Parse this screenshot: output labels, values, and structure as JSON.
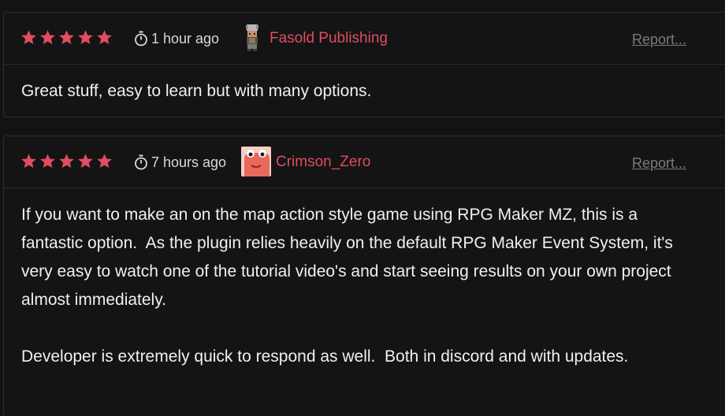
{
  "colors": {
    "background": "#131313",
    "border": "#2d2d2d",
    "star": "#de4d60",
    "author": "#de4d60",
    "report": "#7b7b7b",
    "text": "#f0f0f0"
  },
  "reviews": [
    {
      "rating": 5,
      "time": "1 hour ago",
      "author": "Fasold Publishing",
      "avatar_icon": "pixel-character-chef-avatar",
      "report_label": "Report...",
      "body": "Great stuff, easy to learn but with many options."
    },
    {
      "rating": 5,
      "time": "7 hours ago",
      "author": "Crimson_Zero",
      "avatar_icon": "pink-blob-creature-avatar",
      "report_label": "Report...",
      "body": "If you want to make an on the map action style game using RPG Maker MZ, this is a fantastic option.  As the plugin relies heavily on the default RPG Maker Event System, it's very easy to watch one of the tutorial video's and start seeing results on your own project almost immediately.\n\nDeveloper is extremely quick to respond as well.  Both in discord and with updates."
    }
  ]
}
